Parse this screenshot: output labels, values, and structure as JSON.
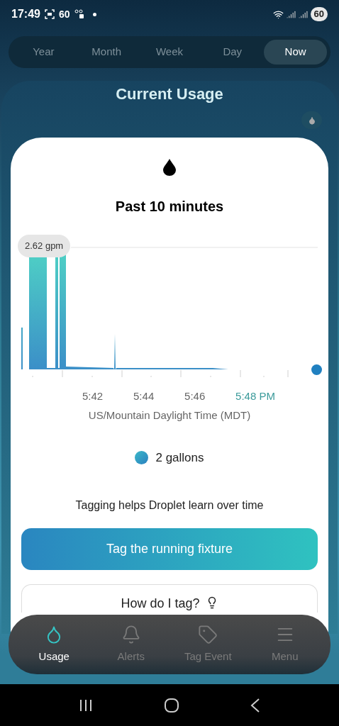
{
  "status_bar": {
    "time": "17:49",
    "indicator": "60",
    "battery": "60"
  },
  "period_tabs": [
    {
      "label": "Year",
      "selected": false
    },
    {
      "label": "Month",
      "selected": false
    },
    {
      "label": "Week",
      "selected": false
    },
    {
      "label": "Day",
      "selected": false
    },
    {
      "label": "Now",
      "selected": true
    }
  ],
  "title": "Current Usage",
  "card": {
    "heading": "Past 10 minutes",
    "chart": {
      "tooltip": "2.62 gpm",
      "x_labels": [
        {
          "label": "5:42",
          "current": false
        },
        {
          "label": "5:44",
          "current": false
        },
        {
          "label": "5:46",
          "current": false
        },
        {
          "label": "5:48 PM",
          "current": true
        }
      ],
      "timezone": "US/Mountain Daylight Time (MDT)"
    },
    "legend": {
      "label": "2 gallons"
    },
    "tagging_hint": "Tagging helps Droplet learn over time",
    "primary_button": "Tag the running fixture",
    "secondary_button": "How do I tag?"
  },
  "bottom_nav": [
    {
      "label": "Usage",
      "selected": true
    },
    {
      "label": "Alerts",
      "selected": false
    },
    {
      "label": "Tag Event",
      "selected": false
    },
    {
      "label": "Menu",
      "selected": false
    }
  ]
}
